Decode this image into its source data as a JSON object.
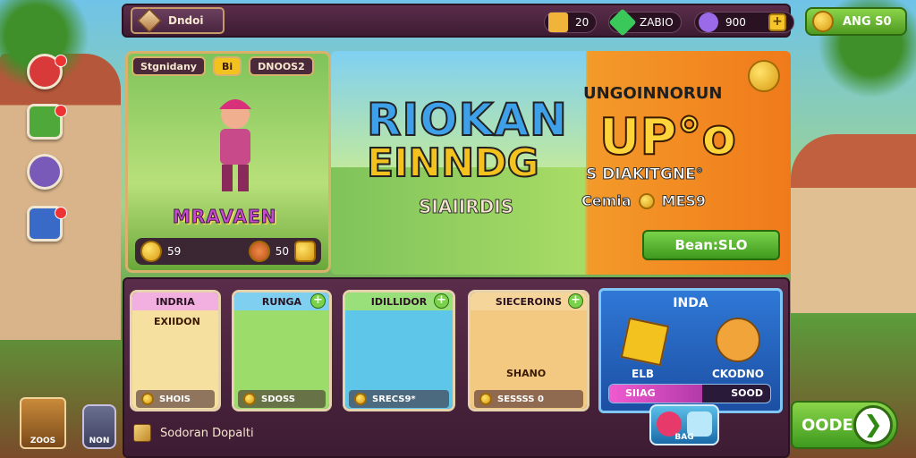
{
  "topbar": {
    "home_label": "Dndoi",
    "resources": [
      {
        "icon": "gold-bar-icon",
        "value": "20"
      },
      {
        "icon": "green-gem-icon",
        "value": "ZABIO"
      },
      {
        "icon": "purple-orb-icon",
        "value": "900"
      }
    ],
    "gold_button_label": "ANG S0"
  },
  "side_buttons": [
    {
      "icon": "ruby-icon",
      "color": "#d83a3a",
      "badge": true
    },
    {
      "icon": "leaf-icon",
      "color": "#4fa83a",
      "badge": true
    },
    {
      "icon": "avatar-icon",
      "color": "#7a5ab8",
      "badge": false
    },
    {
      "icon": "settings-icon",
      "color": "#3a6ac8",
      "badge": true
    }
  ],
  "hero_card": {
    "top_left": "Stgnidany",
    "top_mid": "Bi",
    "top_right": "DNOOS2",
    "title": "MRAVAEN",
    "bottom_left": "59",
    "bottom_right": "50"
  },
  "banner": {
    "title_line1": "RIOKAN",
    "title_line2": "EINNDG",
    "subtitle": "SIAIIRDIS",
    "right_heading": "UNGOINNORUN",
    "right_big": "UP°o",
    "right_sub": "S DIAKITGNE°",
    "right_sub2_a": "Cemia",
    "right_sub2_b": "MES9",
    "button_label": "Bean:SLO"
  },
  "cards": [
    {
      "head": "INDRIA",
      "sub": "EXIIDON",
      "foot": "SHOIS",
      "color": "#f1b0e0",
      "body": "#f6e0a0",
      "plus": false
    },
    {
      "head": "RUNGA",
      "sub": "",
      "foot": "SDOSS",
      "color": "#7fd0f0",
      "body": "#9bdc6a",
      "plus": true
    },
    {
      "head": "IDILLIDOR",
      "sub": "",
      "foot": "SRECS9*",
      "color": "#9ae07a",
      "body": "#5ec6e8",
      "plus": true
    },
    {
      "head": "SIECEROINS",
      "sub": "SHANO",
      "foot": "SESSSS 0",
      "color": "#f6d59a",
      "body": "#f3c880",
      "plus": true
    }
  ],
  "special": {
    "head": "INDA",
    "left_label": "ELB",
    "right_label": "CKODNO",
    "bar_left": "SIIAG",
    "bar_right": "SOOD",
    "progress": 0.58
  },
  "quest": {
    "label": "Sodoran Dopalti"
  },
  "bottom": {
    "chest_label": "ZOOS",
    "bag_label": "NON",
    "mini_label": "BAG",
    "go_label": "OODEN"
  }
}
